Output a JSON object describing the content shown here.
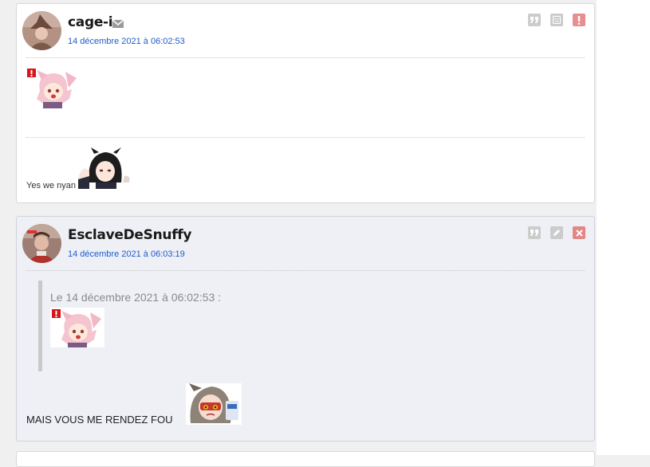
{
  "posts": [
    {
      "author": "cage-i",
      "date": "14 décembre 2021 à 06:02:53",
      "stickers": [
        "nyan-sticker-alert",
        "kaguya-sticker"
      ],
      "text": "Yes we nyan",
      "actions": [
        "quote-icon",
        "sad-face-icon",
        "alert-icon"
      ]
    },
    {
      "author": "EsclaveDeSnuffy",
      "date": "14 décembre 2021 à 06:03:19",
      "quote_header": "Le 14 décembre 2021 à 06:02:53 :",
      "text": "MAIS VOUS ME RENDEZ FOU",
      "actions": [
        "quote-icon",
        "edit-icon",
        "delete-icon"
      ]
    }
  ],
  "colors": {
    "date_link": "#1f5cc7",
    "delete": "#e38686",
    "quote_bar": "#c9c9c9",
    "post2_bg": "#eef0f6"
  }
}
